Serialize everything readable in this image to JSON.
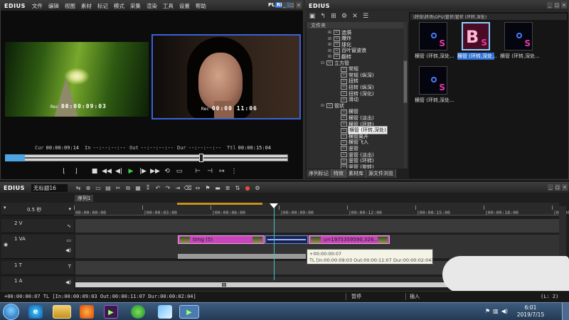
{
  "player": {
    "logo": "EDIUS",
    "menu": [
      "文件",
      "编辑",
      "视图",
      "素材",
      "标记",
      "模式",
      "采集",
      "渲染",
      "工具",
      "设置",
      "帮助"
    ],
    "plr": "PLR",
    "rec": "REC",
    "left_tc_label": "Rec",
    "left_tc": "00:00:09:03",
    "right_tc_label": "Rec",
    "right_tc": "00:00 11:06",
    "info": {
      "cur_label": "Cur",
      "cur": "00:00:09:14",
      "in_label": "In",
      "in": "--:--:--:--",
      "out_label": "Out",
      "out": "--:--:--:--",
      "dur_label": "Dur",
      "dur": "--:--:--:--",
      "ttl_label": "Ttl",
      "ttl": "00:00:15:04"
    },
    "scrub_position": 0.69,
    "controls": [
      "mark-in",
      "mark-out",
      "stop",
      "rewind",
      "step-back",
      "play",
      "step-forward",
      "fast-forward",
      "loop",
      "output",
      "insert",
      "overwrite",
      "replace",
      "more"
    ]
  },
  "library": {
    "logo": "EDIUS",
    "tree_header": "文件夹",
    "path": "\\特效\\转场\\GPU\\管状\\管状 (环转,深处)",
    "tree": [
      {
        "label": "涟漪",
        "indent": 3,
        "type": "node"
      },
      {
        "label": "爆炸",
        "indent": 3,
        "type": "node"
      },
      {
        "label": "球化",
        "indent": 3,
        "type": "node"
      },
      {
        "label": "百叶窗波浪",
        "indent": 3,
        "type": "node"
      },
      {
        "label": "翻转",
        "indent": 3,
        "type": "node"
      },
      {
        "label": "立方管",
        "indent": 2,
        "type": "folder"
      },
      {
        "label": "常规",
        "indent": 4,
        "type": "leaf"
      },
      {
        "label": "常规 (纵深)",
        "indent": 4,
        "type": "leaf"
      },
      {
        "label": "扭转",
        "indent": 4,
        "type": "leaf"
      },
      {
        "label": "扭转 (纵深)",
        "indent": 4,
        "type": "leaf"
      },
      {
        "label": "扭转 (深化)",
        "indent": 4,
        "type": "leaf"
      },
      {
        "label": "滑动",
        "indent": 4,
        "type": "leaf"
      },
      {
        "label": "管状",
        "indent": 2,
        "type": "folder"
      },
      {
        "label": "横管",
        "indent": 4,
        "type": "leaf"
      },
      {
        "label": "横管 (淡出)",
        "indent": 4,
        "type": "leaf"
      },
      {
        "label": "横管 (环转)",
        "indent": 4,
        "type": "leaf"
      },
      {
        "label": "横管 (环转,深处)",
        "indent": 4,
        "type": "leaf",
        "selected": true
      },
      {
        "label": "横管离开",
        "indent": 4,
        "type": "leaf"
      },
      {
        "label": "横管飞入",
        "indent": 4,
        "type": "leaf"
      },
      {
        "label": "竖管",
        "indent": 4,
        "type": "leaf"
      },
      {
        "label": "竖管 (淡出)",
        "indent": 4,
        "type": "leaf"
      },
      {
        "label": "竖管 (环转)",
        "indent": 4,
        "type": "leaf"
      },
      {
        "label": "竖管 (旋转)",
        "indent": 4,
        "type": "leaf"
      }
    ],
    "tabs": [
      "序列标记",
      "特效",
      "素材库",
      "源文件浏览"
    ],
    "active_tab": 1,
    "thumbs": [
      {
        "caption": "横管 (环转,深处...",
        "selected": false
      },
      {
        "caption": "横管 (环转,深处...",
        "selected": true
      },
      {
        "caption": "横管 (环转,深处...",
        "selected": false
      },
      {
        "caption": "横管 (环转,深处...",
        "selected": false
      }
    ],
    "thumb_letter": "S",
    "thumb_big": "B"
  },
  "timeline": {
    "logo": "EDIUS",
    "project": "无标题16",
    "sequence_tab": "序列1",
    "zoom": "0.5 秒",
    "ruler": [
      "00:00:00:00",
      "|00:00:03:00",
      "|00:00:06:00",
      "|00:00:09:00",
      "|00:00:12:00",
      "|00:00:15:00",
      "|00:00:18:00",
      "|00:00:21:00"
    ],
    "tracks": [
      {
        "label": "2 V"
      },
      {
        "label": "1 VA"
      },
      {
        "label": "1 T"
      },
      {
        "label": "1 A"
      }
    ],
    "clip1": "timg (5)",
    "clip2": "u=1975359590,326...",
    "tooltip_line1": "+00:00:00:07",
    "tooltip_line2": "TL [In:00:00:09:03 Out:00:00:11:07 Dur:00:00:02:04]",
    "status_left": "+00:00:00:07 TL [In:00:00:09:03 Out:00:00:11:07 Dur:00:00:02:04]",
    "status_pause": "暂停",
    "status_insert": "插入",
    "status_right": "(L: 2)"
  },
  "taskbar": {
    "time": "6:01",
    "date": "2019/7/15"
  }
}
